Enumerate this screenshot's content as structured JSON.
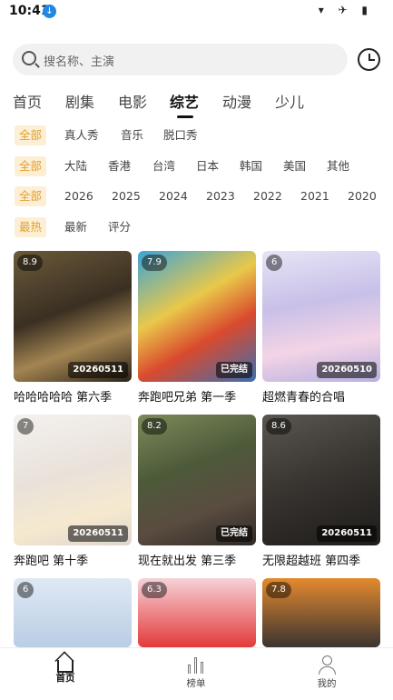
{
  "status": {
    "time": "10:41",
    "download_icon": "download-icon",
    "icons": "▾ ✈ ▮"
  },
  "search": {
    "placeholder": "搜名称、主演",
    "icon": "search-icon"
  },
  "history_icon": "clock-icon",
  "tabs": [
    {
      "label": "首页",
      "active": false
    },
    {
      "label": "剧集",
      "active": false
    },
    {
      "label": "电影",
      "active": false
    },
    {
      "label": "综艺",
      "active": true
    },
    {
      "label": "动漫",
      "active": false
    },
    {
      "label": "少儿",
      "active": false
    }
  ],
  "filters": {
    "type": [
      "全部",
      "真人秀",
      "音乐",
      "脱口秀"
    ],
    "region": [
      "全部",
      "大陆",
      "香港",
      "台湾",
      "日本",
      "韩国",
      "美国",
      "其他"
    ],
    "year": [
      "全部",
      "2026",
      "2025",
      "2024",
      "2023",
      "2022",
      "2021",
      "2020"
    ],
    "sort": [
      "最热",
      "最新",
      "评分"
    ]
  },
  "cards": [
    {
      "title": "哈哈哈哈哈 第六季",
      "rating": "8.9",
      "tag": "20260511"
    },
    {
      "title": "奔跑吧兄弟 第一季",
      "rating": "7.9",
      "tag": "已完结"
    },
    {
      "title": "超燃青春的合唱",
      "rating": "6",
      "tag": "20260510"
    },
    {
      "title": "奔跑吧 第十季",
      "rating": "7",
      "tag": "20260511"
    },
    {
      "title": "现在就出发 第三季",
      "rating": "8.2",
      "tag": "已完结"
    },
    {
      "title": "无限超越班 第四季",
      "rating": "8.6",
      "tag": "20260511"
    },
    {
      "title": "",
      "rating": "6",
      "tag": ""
    },
    {
      "title": "",
      "rating": "6.3",
      "tag": ""
    },
    {
      "title": "",
      "rating": "7.8",
      "tag": ""
    }
  ],
  "bottom_nav": [
    {
      "label": "首页",
      "icon": "home-icon",
      "active": true
    },
    {
      "label": "榜单",
      "icon": "chart-bars-icon",
      "active": false
    },
    {
      "label": "我的",
      "icon": "user-icon",
      "active": false
    }
  ],
  "colors": {
    "accent": "#e3a02e",
    "chip_bg": "#fcefd6"
  }
}
